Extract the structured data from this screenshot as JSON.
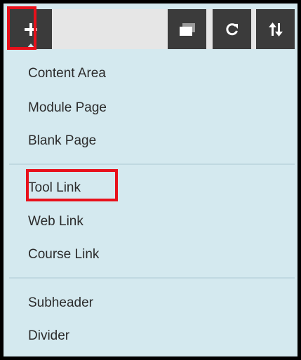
{
  "toolbar": {
    "add_icon": "plus-icon",
    "buttons": [
      {
        "icon": "folder-view-icon"
      },
      {
        "icon": "refresh-icon"
      },
      {
        "icon": "sort-icon"
      }
    ]
  },
  "menu": {
    "groups": [
      {
        "items": [
          "Content Area",
          "Module Page",
          "Blank Page"
        ]
      },
      {
        "items": [
          "Tool Link",
          "Web Link",
          "Course Link"
        ]
      },
      {
        "items": [
          "Subheader",
          "Divider"
        ]
      }
    ]
  },
  "colors": {
    "menu_background": "#d4e9ef",
    "toolbar_button": "#3b3b3b",
    "highlight": "#e8111b",
    "frame": "#000000"
  }
}
